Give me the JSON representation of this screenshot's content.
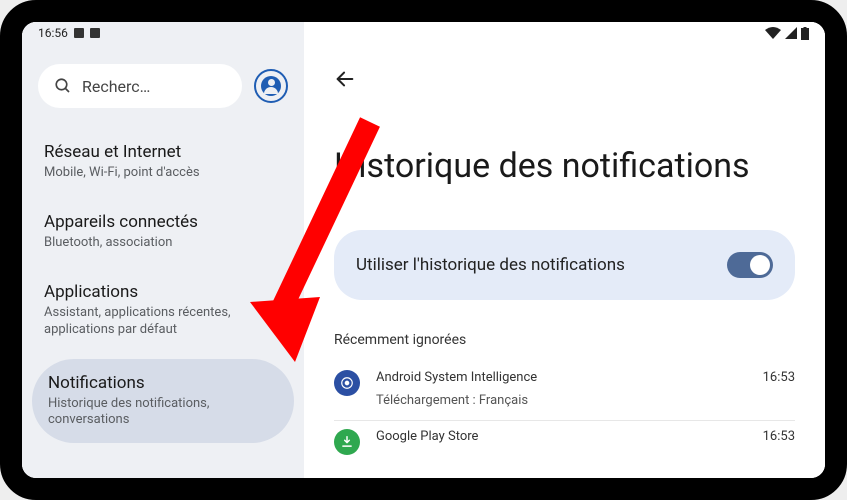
{
  "status_bar": {
    "time": "16:56"
  },
  "sidebar": {
    "search_placeholder": "Recherc…",
    "items": [
      {
        "title": "Réseau et Internet",
        "sub": "Mobile, Wi-Fi, point d'accès",
        "selected": false
      },
      {
        "title": "Appareils connectés",
        "sub": "Bluetooth, association",
        "selected": false
      },
      {
        "title": "Applications",
        "sub": "Assistant, applications récentes, applications par défaut",
        "selected": false
      },
      {
        "title": "Notifications",
        "sub": "Historique des notifications, conversations",
        "selected": true
      }
    ]
  },
  "main": {
    "title": "Historique des notifications",
    "toggle_label": "Utiliser l'historique des notifications",
    "toggle_on": true,
    "section_header": "Récemment ignorées",
    "notifications": [
      {
        "app": "Android System Intelligence",
        "detail": "Téléchargement : Français",
        "time": "16:53",
        "icon_bg": "#2b4fa3",
        "icon_name": "target-icon"
      },
      {
        "app": "Google Play Store",
        "detail": "",
        "time": "16:53",
        "icon_bg": "#2fa84f",
        "icon_name": "download-icon"
      }
    ]
  },
  "annotation_arrow_color": "#ff0000"
}
